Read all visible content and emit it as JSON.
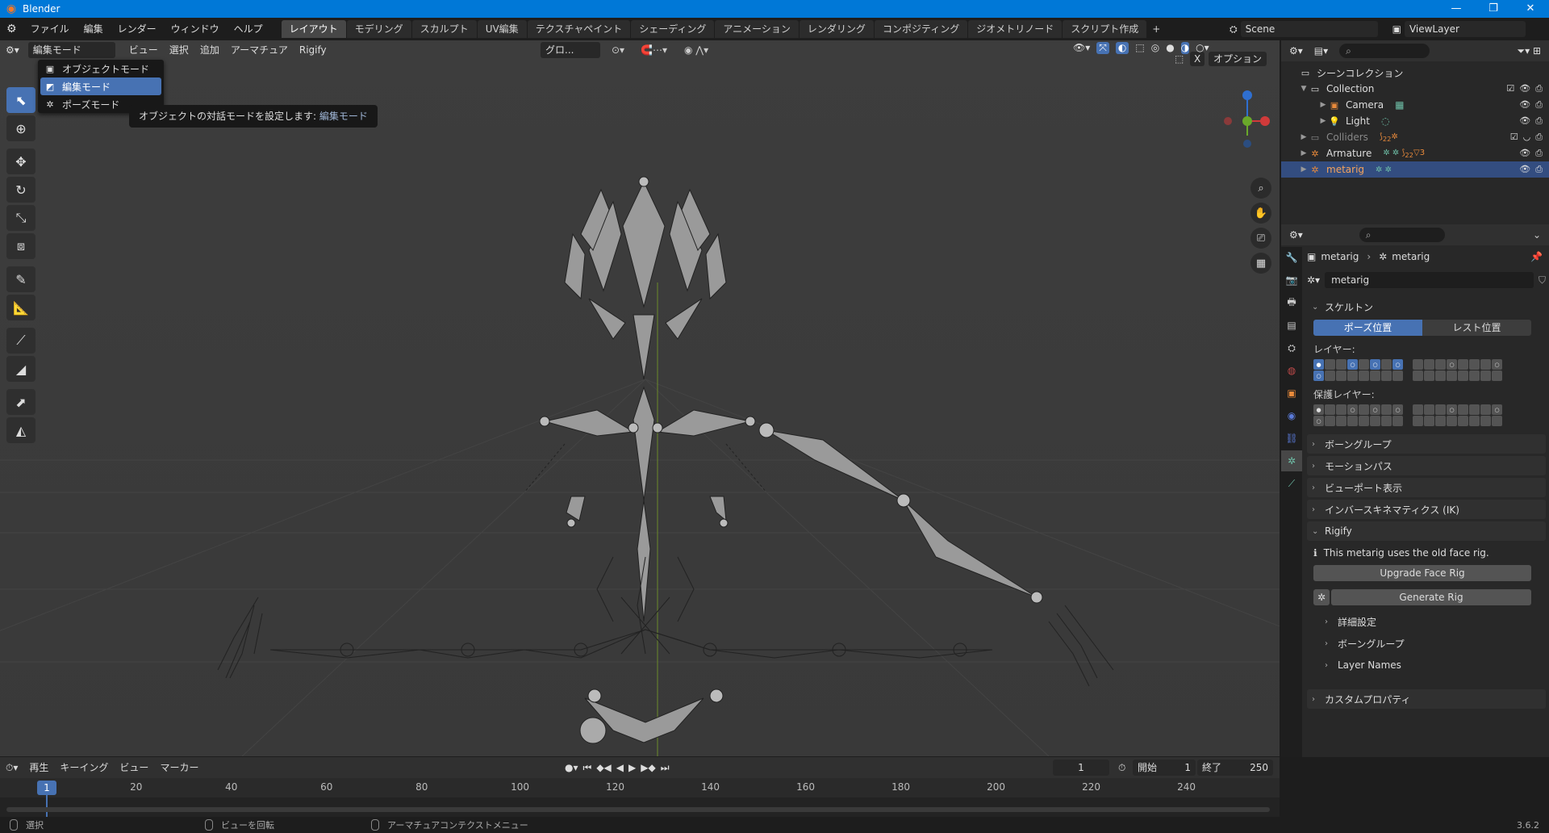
{
  "app": {
    "title": "Blender",
    "version": "3.6.2"
  },
  "menubar": {
    "items": [
      "ファイル",
      "編集",
      "レンダー",
      "ウィンドウ",
      "ヘルプ"
    ]
  },
  "workspaces": {
    "tabs": [
      "レイアウト",
      "モデリング",
      "スカルプト",
      "UV編集",
      "テクスチャペイント",
      "シェーディング",
      "アニメーション",
      "レンダリング",
      "コンポジティング",
      "ジオメトリノード",
      "スクリプト作成"
    ],
    "active": 0,
    "add": "+"
  },
  "scene": {
    "name": "Scene",
    "view_layer": "ViewLayer"
  },
  "viewport_header": {
    "mode": "編集モード",
    "menus": [
      "ビュー",
      "選択",
      "追加",
      "アーマチュア",
      "Rigify"
    ],
    "orientation": "グロ...",
    "options": "オプション",
    "x_toggle": "X"
  },
  "mode_menu": {
    "items": [
      "オブジェクトモード",
      "編集モード",
      "ポーズモード"
    ],
    "selected": 1
  },
  "tooltip": {
    "text": "オブジェクトの対話モードを設定します:",
    "value": "編集モード"
  },
  "outliner": {
    "root": "シーンコレクション",
    "rows": [
      {
        "label": "Collection",
        "level": 1,
        "icon": "collection-icon"
      },
      {
        "label": "Camera",
        "level": 2,
        "icon": "camera-icon"
      },
      {
        "label": "Light",
        "level": 2,
        "icon": "light-icon"
      },
      {
        "label": "Colliders",
        "level": 1,
        "icon": "collection-icon",
        "dim": true
      },
      {
        "label": "Armature",
        "level": 1,
        "icon": "armature-icon"
      },
      {
        "label": "metarig",
        "level": 1,
        "icon": "armature-icon",
        "selected": true
      }
    ],
    "colliders_badge": "22",
    "armature_badges": [
      "22",
      "3"
    ]
  },
  "properties": {
    "breadcrumb": [
      "metarig",
      "metarig"
    ],
    "data_name": "metarig",
    "skeleton": {
      "title": "スケルトン",
      "pose_position": "ポーズ位置",
      "rest_position": "レスト位置",
      "layers_label": "レイヤー:",
      "protected_label": "保護レイヤー:"
    },
    "collapsed": [
      "ボーングループ",
      "モーションパス",
      "ビューポート表示",
      "インバースキネマティクス (IK)"
    ],
    "rigify": {
      "title": "Rigify",
      "info": "This metarig uses the old face rig.",
      "upgrade": "Upgrade Face Rig",
      "generate": "Generate Rig",
      "subpanels": [
        "詳細設定",
        "ボーングループ",
        "Layer Names"
      ]
    },
    "custom_props": "カスタムプロパティ"
  },
  "timeline": {
    "menus": [
      "再生",
      "キーイング",
      "ビュー",
      "マーカー"
    ],
    "current_frame": "1",
    "start_label": "開始",
    "start": "1",
    "end_label": "終了",
    "end": "250",
    "ruler_marks": [
      "20",
      "40",
      "60",
      "80",
      "100",
      "120",
      "140",
      "160",
      "180",
      "200",
      "220",
      "240"
    ],
    "frame_badge": "1"
  },
  "statusbar": {
    "items": [
      "選択",
      "ビューを回転",
      "アーマチュアコンテクストメニュー"
    ]
  },
  "colors": {
    "accent": "#4772b3",
    "titlebar": "#0078d7",
    "viewport": "#3b3b3b"
  }
}
